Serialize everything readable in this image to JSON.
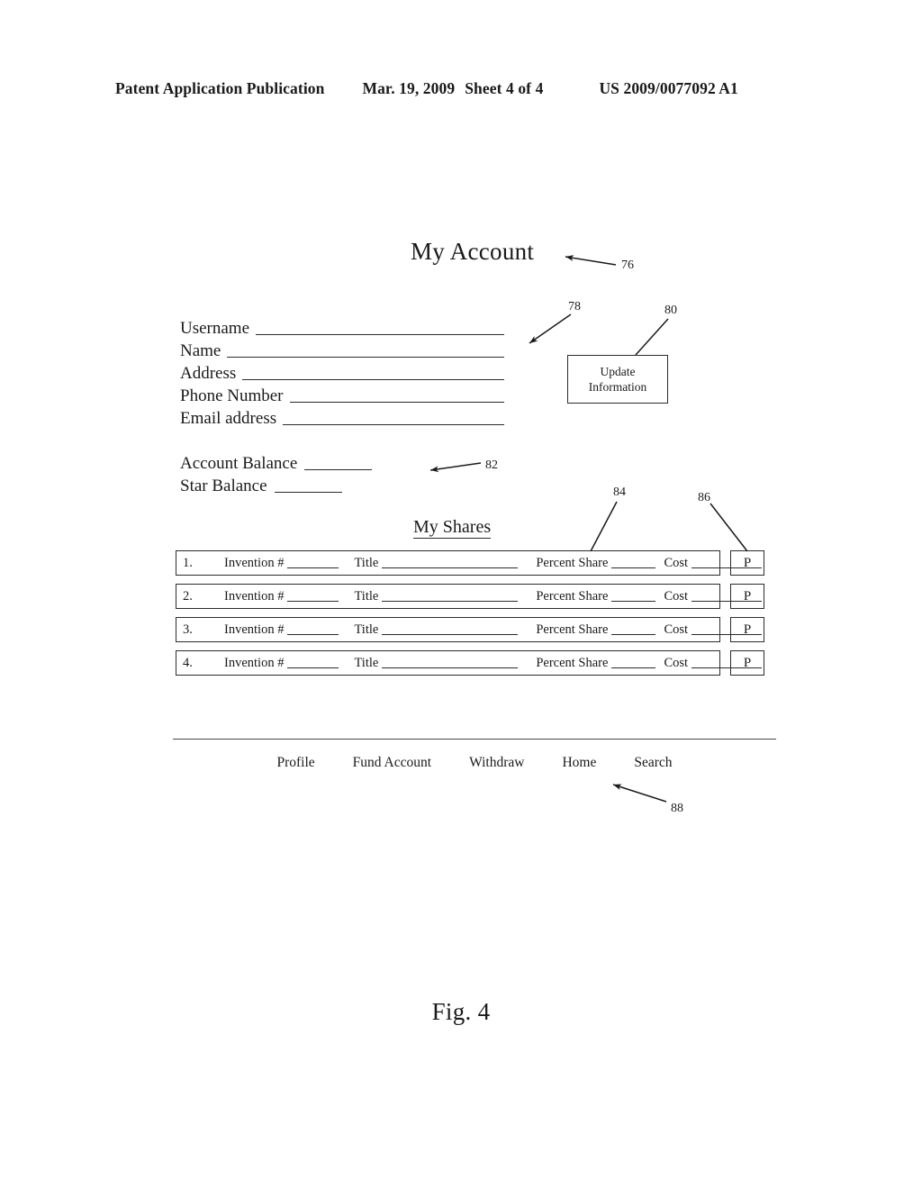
{
  "page_header": {
    "publication": "Patent Application Publication",
    "date": "Mar. 19, 2009",
    "sheet": "Sheet 4 of 4",
    "patent_number": "US 2009/0077092 A1"
  },
  "figure": {
    "title": "My Account",
    "caption": "Fig. 4"
  },
  "account_form": {
    "fields": [
      {
        "label": "Username"
      },
      {
        "label": "Name"
      },
      {
        "label": "Address"
      },
      {
        "label": "Phone Number"
      },
      {
        "label": "Email address"
      }
    ]
  },
  "balances": {
    "items": [
      {
        "label": "Account Balance"
      },
      {
        "label": "Star Balance"
      }
    ]
  },
  "update_button": {
    "line1": "Update",
    "line2": "Information"
  },
  "shares": {
    "heading": "My Shares",
    "columns": {
      "invention": "Invention #",
      "title": "Title",
      "percent_share": "Percent Share",
      "cost": "Cost"
    },
    "p_button_label": "P",
    "rows": [
      {
        "index": "1."
      },
      {
        "index": "2."
      },
      {
        "index": "3."
      },
      {
        "index": "4."
      }
    ]
  },
  "footer_nav": {
    "items": [
      {
        "label": "Profile"
      },
      {
        "label": "Fund Account"
      },
      {
        "label": "Withdraw"
      },
      {
        "label": "Home"
      },
      {
        "label": "Search"
      }
    ]
  },
  "reference_numerals": [
    {
      "id": "76",
      "label": "76"
    },
    {
      "id": "78",
      "label": "78"
    },
    {
      "id": "80",
      "label": "80"
    },
    {
      "id": "82",
      "label": "82"
    },
    {
      "id": "84",
      "label": "84"
    },
    {
      "id": "86",
      "label": "86"
    },
    {
      "id": "88",
      "label": "88"
    }
  ],
  "colors": {
    "ink": "#1a1a1a",
    "line": "#2b2b2b",
    "paper": "#ffffff"
  }
}
